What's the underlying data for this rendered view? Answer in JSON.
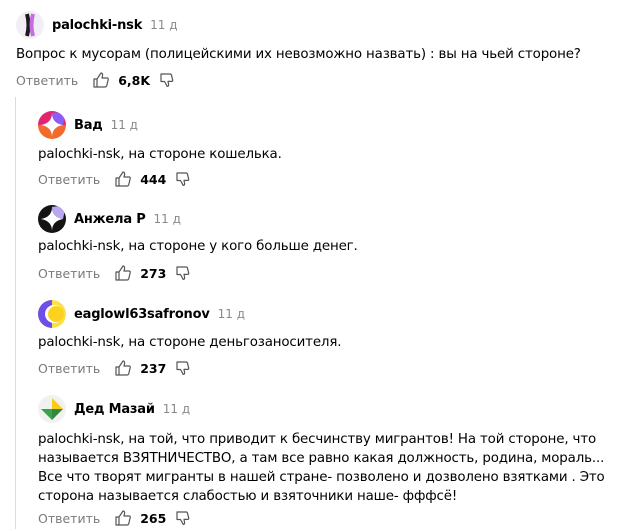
{
  "colors": {
    "text": "#000000",
    "muted": "#7a7a7a",
    "thread_line": "#dcdcdc"
  },
  "icons": {
    "like": "thumb-up-icon",
    "dislike": "thumb-down-icon"
  },
  "comments": [
    {
      "author": "palochki-nsk",
      "time": "11 д",
      "text": "Вопрос к мусорам (полицейскими их невозможно назвать) : вы на чьей стороне?",
      "reply_label": "Ответить",
      "likes": "6,8K"
    },
    {
      "author": "Вад",
      "time": "11 д",
      "text": "palochki-nsk, на стороне кошелька.",
      "reply_label": "Ответить",
      "likes": "444"
    },
    {
      "author": "Анжела Р",
      "time": "11 д",
      "text": "palochki-nsk, на стороне у кого больше денег.",
      "reply_label": "Ответить",
      "likes": "273"
    },
    {
      "author": "eaglowl63safronov",
      "time": "11 д",
      "text": "palochki-nsk, на стороне деньгозаносителя.",
      "reply_label": "Ответить",
      "likes": "237"
    },
    {
      "author": "Дед Мазай",
      "time": "11 д",
      "text_lines": [
        "palochki-nsk, на той, что приводит к бесчинству мигрантов! На той стороне, что",
        "называется ВЗЯТНИЧЕСТВО, а там все равно какая должность, родина, мораль...",
        "Все что творят мигранты в нашей стране- позволено и дозволено взятками . Это",
        "сторона называется слабостью и взяточники наше- фффсё!"
      ],
      "reply_label": "Ответить",
      "likes": "265"
    }
  ]
}
